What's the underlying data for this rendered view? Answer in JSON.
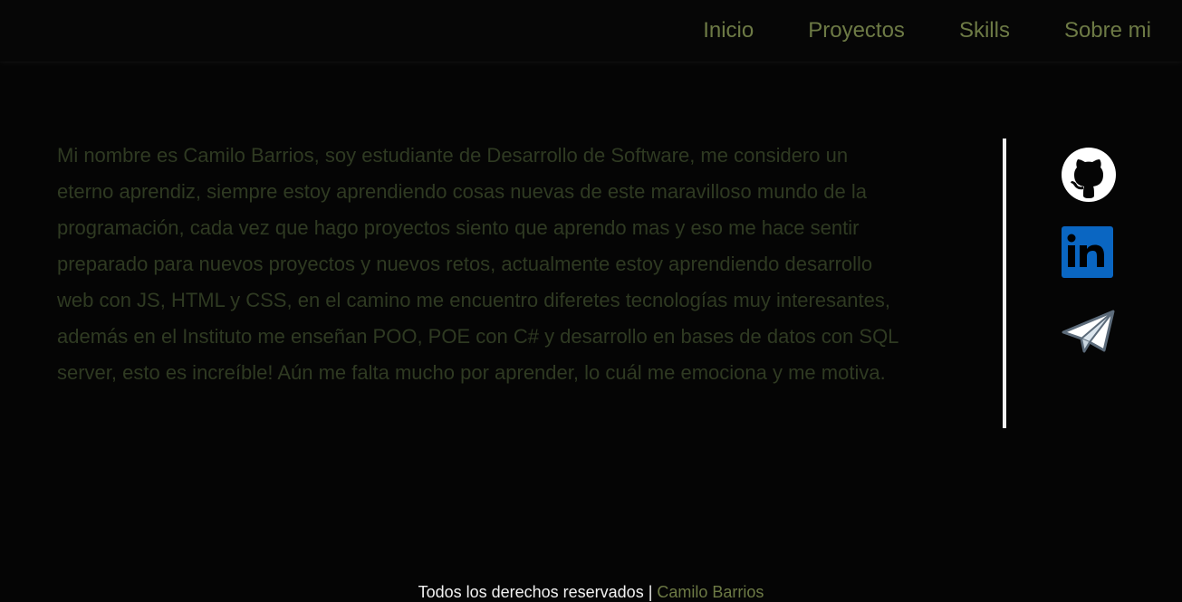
{
  "nav": {
    "items": [
      {
        "label": "Inicio"
      },
      {
        "label": "Proyectos"
      },
      {
        "label": "Skills"
      },
      {
        "label": "Sobre mi"
      }
    ]
  },
  "about": {
    "text": "Mi nombre es Camilo Barrios, soy estudiante de Desarrollo de Software, me considero un eterno aprendiz, siempre estoy aprendiendo cosas nuevas de este maravilloso mundo de la programación, cada vez que hago proyectos siento que aprendo mas y eso me hace sentir preparado para nuevos proyectos y nuevos retos, actualmente estoy aprendiendo desarrollo web con JS, HTML y CSS, en el camino me encuentro diferetes tecnologías muy interesantes, además en el Instituto me enseñan POO, POE con C# y desarrollo en bases de datos con SQL server, esto es increíble! Aún me falta mucho por aprender, lo cuál me emociona y me motiva."
  },
  "social": {
    "icons": [
      "github-icon",
      "linkedin-icon",
      "telegram-icon"
    ],
    "linkedin_text": "in"
  },
  "footer": {
    "rights": "Todos los derechos reservados |",
    "author": "Camilo Barrios"
  },
  "colors": {
    "background": "#050505",
    "accent": "#6d7a45",
    "body_text": "#2f3a22",
    "divider": "#f2f2f2",
    "linkedin_blue": "#0a66c2"
  }
}
